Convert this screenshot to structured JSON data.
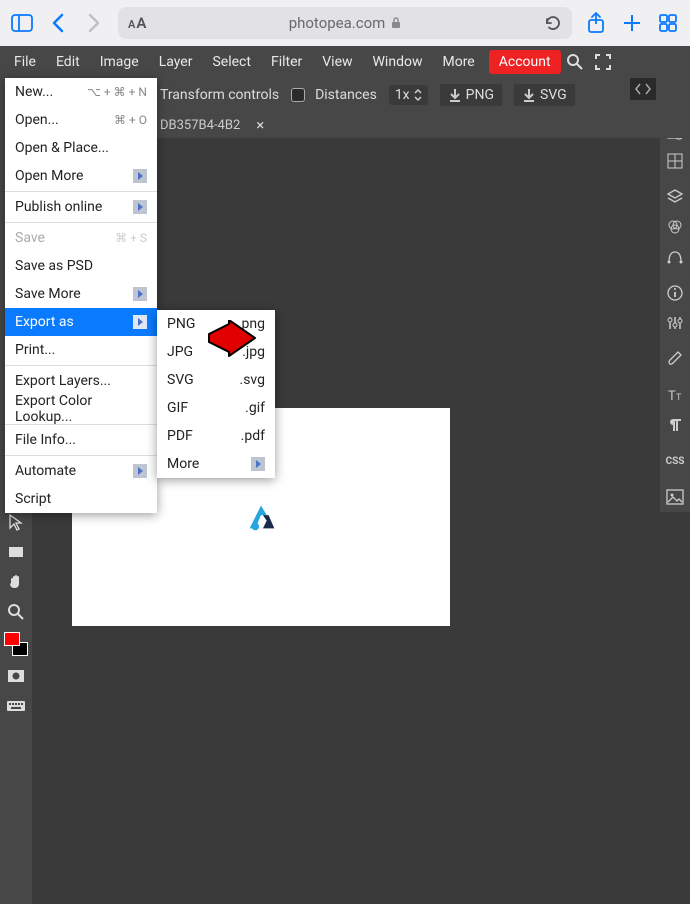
{
  "browser": {
    "address": "photopea.com"
  },
  "menubar": {
    "items": [
      "File",
      "Edit",
      "Image",
      "Layer",
      "Select",
      "Filter",
      "View",
      "Window",
      "More"
    ],
    "account": "Account"
  },
  "toolbar": {
    "transform_controls": "Transform controls",
    "distances": "Distances",
    "zoom": "1x",
    "png": "PNG",
    "svg": "SVG"
  },
  "tab": {
    "filename": "DB357B4-4B2"
  },
  "file_menu": {
    "new": "New...",
    "new_shortcut": "⌥ + ⌘ + N",
    "open": "Open...",
    "open_shortcut": "⌘ + O",
    "open_place": "Open & Place...",
    "open_more": "Open More",
    "publish": "Publish online",
    "save": "Save",
    "save_shortcut": "⌘ + S",
    "save_psd": "Save as PSD",
    "save_more": "Save More",
    "export_as": "Export as",
    "print": "Print...",
    "export_layers": "Export Layers...",
    "export_color": "Export Color Lookup...",
    "file_info": "File Info...",
    "automate": "Automate",
    "script": "Script"
  },
  "export_menu": {
    "png": "PNG",
    "png_ext": ".png",
    "jpg": "JPG",
    "jpg_ext": ".jpg",
    "svg": "SVG",
    "svg_ext": ".svg",
    "gif": "GIF",
    "gif_ext": ".gif",
    "pdf": "PDF",
    "pdf_ext": ".pdf",
    "more": "More"
  }
}
